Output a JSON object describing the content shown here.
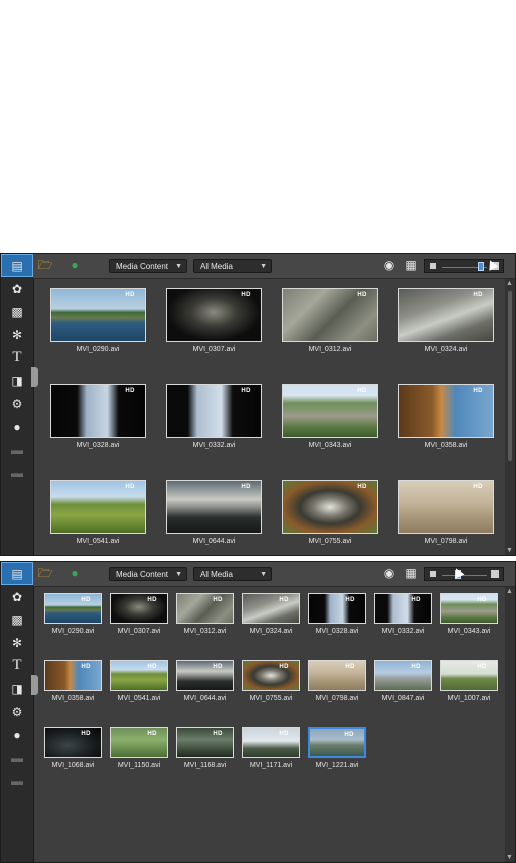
{
  "toolbar": {
    "dropdown_content": "Media Content",
    "dropdown_filter": "All Media"
  },
  "sidebar_icons": [
    "media-room-icon",
    "fx-icon",
    "pip-icon",
    "particle-icon",
    "title-icon",
    "transition-icon",
    "audio-mixing-icon",
    "voice-over-icon",
    "chapter-icon",
    "subtitle-icon"
  ],
  "panel1": {
    "zoom_level": 0.82,
    "files": [
      {
        "name": "MVI_0290.avi",
        "bg": "linear-gradient(#8fb7d8 0%, #b9cfe0 38%, #3a6a3a 45%, #6a7a4a 55%, #2f5d7f 65%, #1e4566 100%)"
      },
      {
        "name": "MVI_0307.avi",
        "bg": "radial-gradient(ellipse at 50% 45%, #8a8a80 0%, #3a3a35 35%, #0d0d0d 70%)"
      },
      {
        "name": "MVI_0312.avi",
        "bg": "linear-gradient(135deg, #7d7f74 0%, #a5a79b 30%, #5a5d52 55%, #8c8f82 80%, #6b6e63 100%)"
      },
      {
        "name": "MVI_0324.avi",
        "bg": "linear-gradient(160deg, #595b55 0%, #8d8f88 35%, #c9cbc6 55%, #6d6f68 75%, #45473f 100%)"
      },
      {
        "name": "MVI_0328.avi",
        "bg": "linear-gradient(90deg, #050505 0%, #0a0a0a 28%, #9fb2c6 38%, #c7d6e5 60%, #0a0a0a 72%, #050505 100%)"
      },
      {
        "name": "MVI_0332.avi",
        "bg": "linear-gradient(90deg, #0a0a0a 0%, #0a0a0a 22%, #aebfd1 32%, #d1dde9 58%, #0d0d0d 70%, #050505 100%)"
      },
      {
        "name": "MVI_0343.avi",
        "bg": "linear-gradient(#cfe0ef 0%, #d9e6f1 20%, #6f8f5a 35%, #9c9b8c 60%, #5d7a45 80%, #3e5b2e 100%)"
      },
      {
        "name": "MVI_0358.avi",
        "bg": "linear-gradient(90deg, #5b3a1c 0%, #8a5a2b 35%, #c78a44 45%, #4f87bb 60%, #79a6cf 100%)"
      },
      {
        "name": "MVI_0541.avi",
        "bg": "linear-gradient(#9ec3e3 0%, #c9dced 30%, #6f8f3a 45%, #8aa544 65%, #4d6e25 100%)"
      },
      {
        "name": "MVI_0644.avi",
        "bg": "linear-gradient(#5e6a74 0%, #c8c9c2 35%, #8c8f8a 50%, #2b2f2e 70%, #151818 100%)"
      },
      {
        "name": "MVI_0755.avi",
        "bg": "radial-gradient(ellipse at 50% 50%, #e4e4dc 0%, #7a786d 25%, #3a3a33 45%, #8a5b2a 70%, #5b7a3a 100%)"
      },
      {
        "name": "MVI_0798.avi",
        "bg": "linear-gradient(#d8cdb8 0%, #c4b59b 40%, #a89679 70%, #8f7c60 100%)"
      }
    ]
  },
  "panel2": {
    "zoom_level": 0.35,
    "files": [
      {
        "name": "MVI_0290.avi",
        "bg": "linear-gradient(#8fb7d8 0%, #b9cfe0 38%, #3a6a3a 45%, #6a7a4a 55%, #2f5d7f 65%, #1e4566 100%)"
      },
      {
        "name": "MVI_0307.avi",
        "bg": "radial-gradient(ellipse at 50% 45%, #8a8a80 0%, #3a3a35 35%, #0d0d0d 70%)"
      },
      {
        "name": "MVI_0312.avi",
        "bg": "linear-gradient(135deg, #7d7f74 0%, #a5a79b 30%, #5a5d52 55%, #8c8f82 80%, #6b6e63 100%)"
      },
      {
        "name": "MVI_0324.avi",
        "bg": "linear-gradient(160deg, #595b55 0%, #8d8f88 35%, #c9cbc6 55%, #6d6f68 75%, #45473f 100%)"
      },
      {
        "name": "MVI_0328.avi",
        "bg": "linear-gradient(90deg, #050505 0%, #0a0a0a 28%, #9fb2c6 38%, #c7d6e5 60%, #0a0a0a 72%, #050505 100%)"
      },
      {
        "name": "MVI_0332.avi",
        "bg": "linear-gradient(90deg, #0a0a0a 0%, #0a0a0a 22%, #aebfd1 32%, #d1dde9 58%, #0d0d0d 70%, #050505 100%)"
      },
      {
        "name": "MVI_0343.avi",
        "bg": "linear-gradient(#cfe0ef 0%, #d9e6f1 20%, #6f8f5a 35%, #9c9b8c 60%, #5d7a45 80%, #3e5b2e 100%)"
      },
      {
        "name": "MVI_0358.avi",
        "bg": "linear-gradient(90deg, #5b3a1c 0%, #8a5a2b 35%, #c78a44 45%, #4f87bb 60%, #79a6cf 100%)"
      },
      {
        "name": "MVI_0541.avi",
        "bg": "linear-gradient(#9ec3e3 0%, #c9dced 30%, #6f8f3a 45%, #8aa544 65%, #4d6e25 100%)"
      },
      {
        "name": "MVI_0644.avi",
        "bg": "linear-gradient(#5e6a74 0%, #c8c9c2 35%, #8c8f8a 50%, #2b2f2e 70%, #151818 100%)"
      },
      {
        "name": "MVI_0755.avi",
        "bg": "radial-gradient(ellipse at 50% 50%, #e4e4dc 0%, #7a786d 25%, #3a3a33 45%, #8a5b2a 70%, #5b7a3a 100%)"
      },
      {
        "name": "MVI_0798.avi",
        "bg": "linear-gradient(#d8cdb8 0%, #c4b59b 40%, #a89679 70%, #8f7c60 100%)"
      },
      {
        "name": "MVI_0847.avi",
        "bg": "linear-gradient(#8fb3d6 0%, #b7cde2 40%, #9a9f9e 60%, #5d6b52 100%)"
      },
      {
        "name": "MVI_1007.avi",
        "bg": "linear-gradient(#e6ebe6 0%, #d4ddd2 45%, #6f8a4a 60%, #4f6a33 100%)"
      },
      {
        "name": "MVI_1068.avi",
        "bg": "radial-gradient(ellipse at 40% 60%, #3c4548 0%, #151a1b 60%, #050606 100%)"
      },
      {
        "name": "MVI_1150.avi",
        "bg": "linear-gradient(#6f8f5a 0%, #8bb06b 40%, #4d6e35 100%)"
      },
      {
        "name": "MVI_1168.avi",
        "bg": "linear-gradient(#3a4a3a 0%, #6b7d6a 40%, #1f2a1f 100%)"
      },
      {
        "name": "MVI_1171.avi",
        "bg": "linear-gradient(#c9d4db 0%, #e3e8ec 45%, #4d5d48 70%, #2f3d2c 100%)"
      },
      {
        "name": "MVI_1221.avi",
        "bg": "linear-gradient(#8ea7bb 0%, #a9bccb 40%, #6b7c6a 60%, #3a5a4e 100%)",
        "selected": true
      }
    ]
  },
  "badge_text": "HD"
}
